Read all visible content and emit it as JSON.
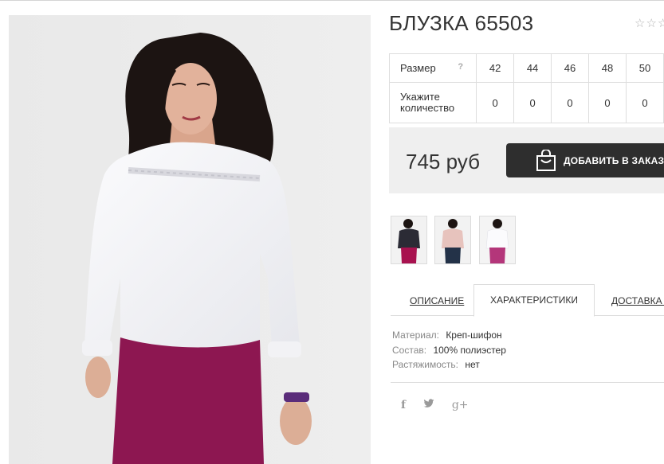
{
  "product": {
    "title": "БЛУЗКА 65503",
    "rating_stars": "☆☆☆",
    "price": "745 руб",
    "add_to_order_label": "ДОБАВИТЬ В ЗАКАЗ"
  },
  "sizes_table": {
    "size_label": "Размер",
    "help_glyph": "?",
    "qty_label_line1": "Укажите",
    "qty_label_line2": "количество",
    "sizes": [
      "42",
      "44",
      "46",
      "48",
      "50"
    ],
    "quantities": [
      "0",
      "0",
      "0",
      "0",
      "0"
    ]
  },
  "thumbnails": [
    {
      "name": "thumb-black-blouse",
      "top": "#2b2b35",
      "bottom": "#a8124f"
    },
    {
      "name": "thumb-pink-blouse",
      "top": "#e7c3bd",
      "bottom": "#233248"
    },
    {
      "name": "thumb-white-blouse",
      "top": "#f3f3f6",
      "bottom": "#b4367a"
    }
  ],
  "tabs": {
    "description": "ОПИСАНИЕ",
    "characteristics": "ХАРАКТЕРИСТИКИ",
    "delivery": "ДОСТАВКА И"
  },
  "specs": [
    {
      "key": "Материал:",
      "value": "Креп-шифон"
    },
    {
      "key": "Состав:",
      "value": "100% полиэстер"
    },
    {
      "key": "Растяжимость:",
      "value": "нет"
    }
  ],
  "social": {
    "facebook": "f",
    "twitter": "🐦",
    "googleplus": "g+"
  },
  "colors": {
    "button_bg": "#2e2e2e",
    "price_box_bg": "#efefef",
    "trousers": "#8d1751",
    "blouse": "#f7f7fa"
  }
}
